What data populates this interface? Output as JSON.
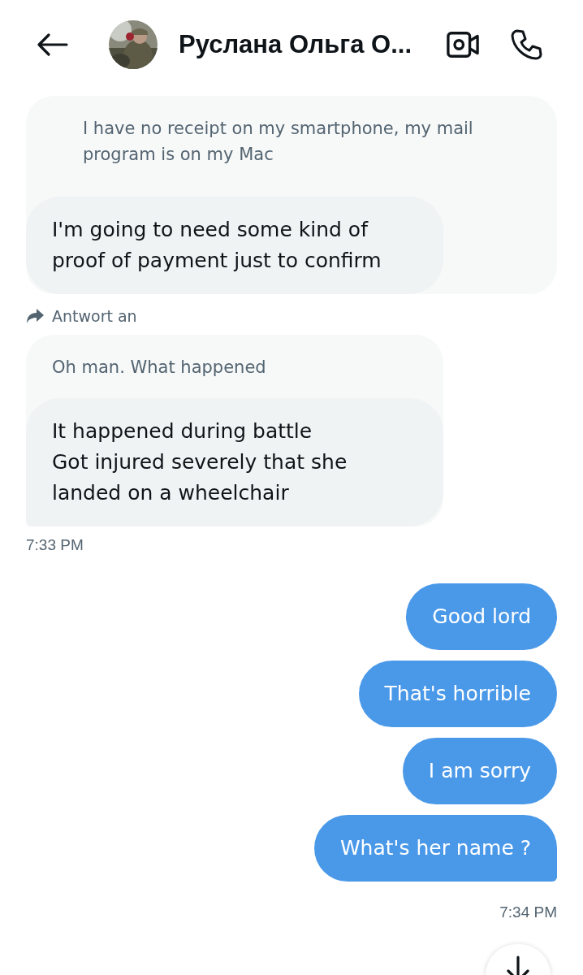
{
  "header": {
    "title": "Руслана Ольга О..."
  },
  "messages": [
    {
      "kind": "received",
      "quote": "I have no receipt on my smartphone, my mail program is on my Mac",
      "text": "I'm going to need some kind of proof of payment just to confirm",
      "tail": false
    },
    {
      "kind": "reply_label",
      "text": "Antwort an"
    },
    {
      "kind": "received",
      "quote": "Oh man. What happened",
      "text": "It happened during battle\nGot injured severely that she landed on a wheelchair",
      "tail": true
    },
    {
      "kind": "time",
      "text": "7:33 PM"
    },
    {
      "kind": "sent",
      "text": "Good lord",
      "tail": false
    },
    {
      "kind": "sent",
      "text": "That's horrible",
      "tail": false
    },
    {
      "kind": "sent",
      "text": "I am sorry",
      "tail": false
    },
    {
      "kind": "sent",
      "text": "What's her name ?",
      "tail": true
    },
    {
      "kind": "time",
      "text": "7:34 PM"
    }
  ]
}
